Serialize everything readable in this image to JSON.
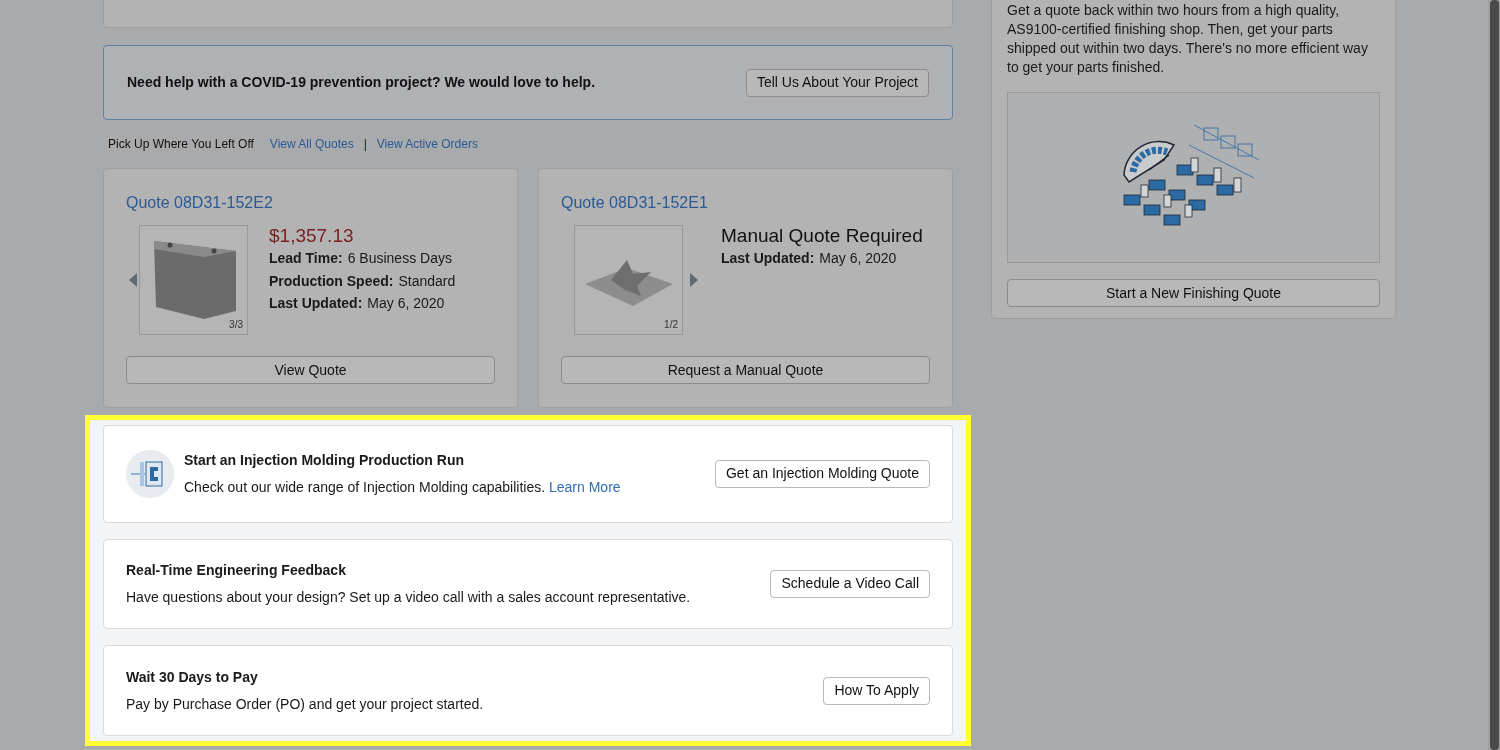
{
  "covid_banner": {
    "text": "Need help with a COVID-19 prevention project? We would love to help.",
    "button": "Tell Us About Your Project"
  },
  "recent": {
    "label": "Pick Up Where You Left Off",
    "links": [
      "View All Quotes",
      "View Active Orders"
    ],
    "separator": "|"
  },
  "quotes": [
    {
      "kind": "priced",
      "title": "Quote 08D31-152E2",
      "headline": "$1,357.13",
      "details": [
        {
          "label": "Lead Time:",
          "value": "6 Business Days"
        },
        {
          "label": "Production Speed:",
          "value": "Standard"
        },
        {
          "label": "Last Updated:",
          "value": "May 6, 2020"
        }
      ],
      "image_counter": "3/3",
      "prev_arrow": true,
      "next_arrow": false,
      "button": "View Quote"
    },
    {
      "kind": "manual",
      "title": "Quote 08D31-152E1",
      "headline": "Manual Quote Required",
      "details": [
        {
          "label": "Last Updated:",
          "value": "May 6, 2020"
        }
      ],
      "image_counter": "1/2",
      "prev_arrow": false,
      "next_arrow": true,
      "button": "Request a Manual Quote"
    }
  ],
  "finishing": {
    "description": "Get a quote back within two hours from a high quality, AS9100-certified finishing shop. Then, get your parts shipped out within two days. There's no more efficient way to get your parts finished.",
    "button": "Start a New Finishing Quote"
  },
  "promos": [
    {
      "kind": "icon",
      "title": "Start an Injection Molding Production Run",
      "text": "Check out our wide range of Injection Molding capabilities.",
      "link": "Learn More",
      "button": "Get an Injection Molding Quote"
    },
    {
      "kind": "plain",
      "title": "Real-Time Engineering Feedback",
      "text": "Have questions about your design? Set up a video call with a sales account representative.",
      "button": "Schedule a Video Call"
    },
    {
      "kind": "plain",
      "title": "Wait 30 Days to Pay",
      "text": "Pay by Purchase Order (PO) and get your project started.",
      "button": "How To Apply"
    }
  ]
}
